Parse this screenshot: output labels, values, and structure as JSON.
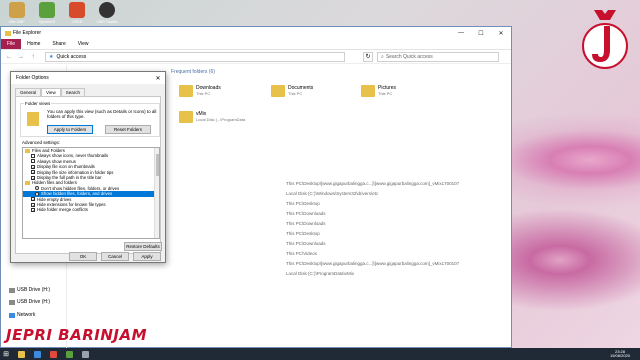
{
  "desktop": {
    "icons": [
      {
        "label": "Mic DBF",
        "color": "#cfa04a"
      },
      {
        "label": "Spinner3",
        "color": "#5aa03c"
      },
      {
        "label": "CRKE",
        "color": "#d74a2a"
      },
      {
        "label": "OBS Studio",
        "color": "#333333"
      }
    ]
  },
  "explorer": {
    "title": "File Explorer",
    "tabs": [
      "File",
      "Home",
      "Share",
      "View"
    ],
    "address": "Quick access",
    "search_placeholder": "Search Quick access",
    "frequent_header": "Frequent folders (6)",
    "folders": [
      {
        "name": "Downloads",
        "sub": "This PC"
      },
      {
        "name": "Documents",
        "sub": "This PC"
      },
      {
        "name": "Pictures",
        "sub": "This PC"
      },
      {
        "name": "vMix",
        "sub": "Local Disk (...\\ProgramData"
      }
    ],
    "recent_paths": [
      "This PC\\Desktop\\[www.gigapurbalingga.c...]\\[www.gigapurbalingga.com]_vMix1700107",
      "Local Disk (C:)\\Windows\\System32\\drivers\\etc",
      "This PC\\Desktop",
      "This PC\\Downloads",
      "This PC\\Downloads",
      "This PC\\Desktop",
      "This PC\\Downloads",
      "This PC\\Videos",
      "This PC\\Desktop\\[www.gigapurbalingga.c...]\\[www.gigapurbalingga.com]_vMix1700107",
      "Local Disk (C:)\\ProgramData\\vMix"
    ],
    "nav": [
      {
        "label": "USB Drive (H:)"
      },
      {
        "label": "USB Drive (H:)"
      },
      {
        "label": "Network"
      }
    ]
  },
  "dialog": {
    "title": "Folder Options",
    "tabs": [
      "General",
      "View",
      "Search"
    ],
    "folder_views_label": "Folder views",
    "folder_views_text": "You can apply this view (such as Details or Icons) to all folders of this type.",
    "apply_button": "Apply to Folders",
    "reset_button": "Reset Folders",
    "advanced_label": "Advanced settings:",
    "settings": [
      {
        "label": "Files and Folders",
        "type": "folder"
      },
      {
        "label": "Always show icons, never thumbnails",
        "checked": false
      },
      {
        "label": "Always show menus",
        "checked": false
      },
      {
        "label": "Display file icon on thumbnails",
        "checked": true
      },
      {
        "label": "Display file size information in folder tips",
        "checked": true
      },
      {
        "label": "Display the full path in the title bar",
        "checked": true
      },
      {
        "label": "Hidden files and folders",
        "type": "folder"
      },
      {
        "label": "Don't show hidden files, folders, or drives",
        "checked": false,
        "indent": true
      },
      {
        "label": "Show hidden files, folders, and drives",
        "checked": true,
        "indent": true,
        "selected": true
      },
      {
        "label": "Hide empty drives",
        "checked": true
      },
      {
        "label": "Hide extensions for known file types",
        "checked": true
      },
      {
        "label": "Hide folder merge conflicts",
        "checked": true
      }
    ],
    "restore_button": "Restore Defaults",
    "ok_button": "OK",
    "cancel_button": "Cancel",
    "apply_bottom_button": "Apply"
  },
  "taskbar": {
    "time": "23:28",
    "date": "15/08/2020",
    "apps": [
      "#e8c14a",
      "#3c8be0",
      "#e04a3c",
      "#5aa03c",
      "#9aa3ad"
    ]
  },
  "watermark": "JEPRI BARINJAM",
  "logo_text": "J"
}
